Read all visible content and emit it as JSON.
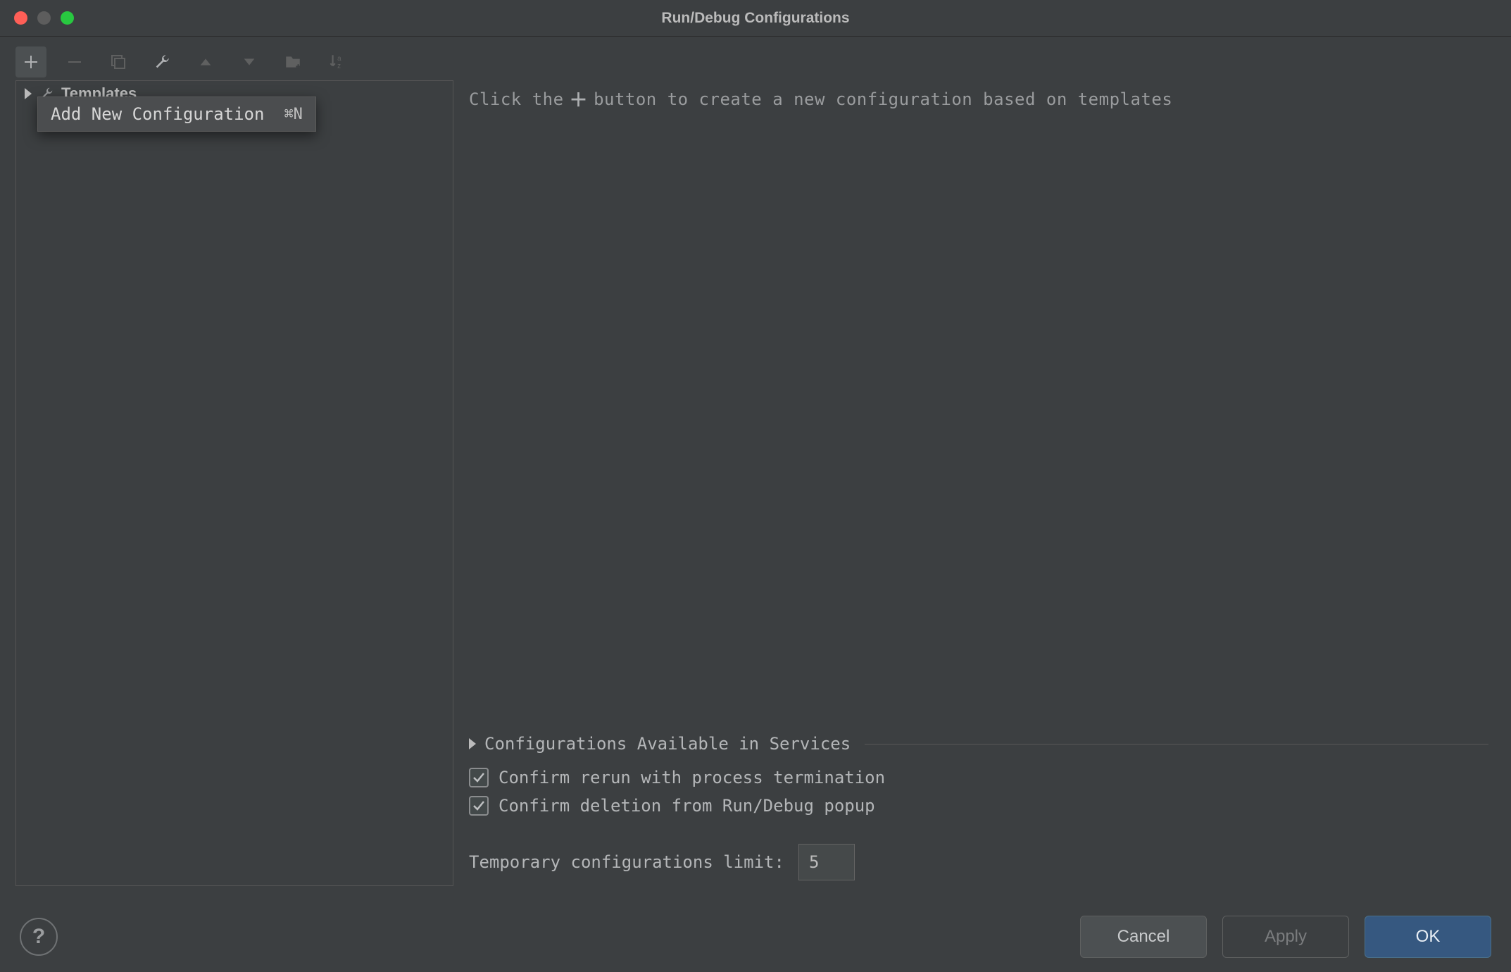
{
  "window": {
    "title": "Run/Debug Configurations"
  },
  "toolbar_tooltip": {
    "text": "Add New Configuration",
    "shortcut": "⌘N"
  },
  "sidebar": {
    "templates_label": "Templates"
  },
  "main": {
    "hint_prefix": "Click the",
    "hint_suffix": "button to create a new configuration based on templates",
    "section_label": "Configurations Available in Services",
    "confirm_rerun": "Confirm rerun with process termination",
    "confirm_delete": "Confirm deletion from Run/Debug popup",
    "limit_label": "Temporary configurations limit:",
    "limit_value": "5"
  },
  "footer": {
    "help": "?",
    "cancel": "Cancel",
    "apply": "Apply",
    "ok": "OK"
  }
}
